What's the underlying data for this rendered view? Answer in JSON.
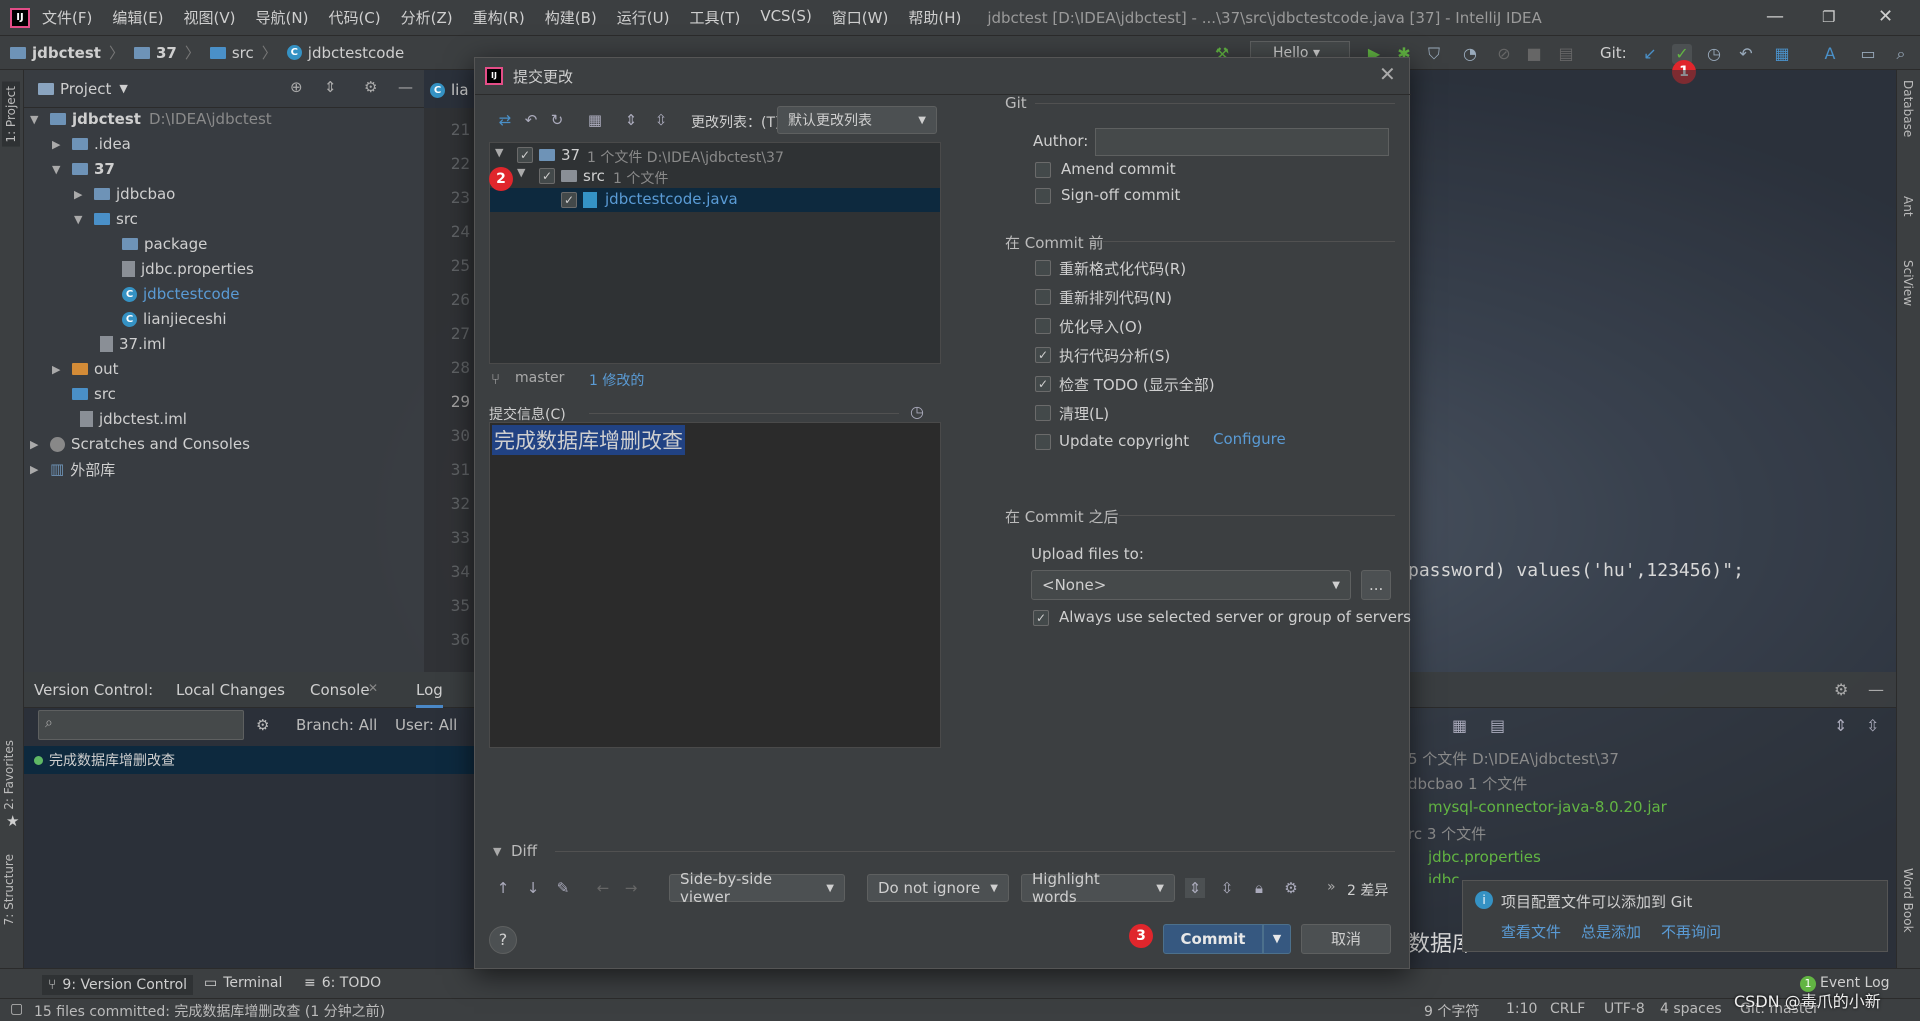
{
  "titlebar": {
    "menus": [
      "文件(F)",
      "编辑(E)",
      "视图(V)",
      "导航(N)",
      "代码(C)",
      "分析(Z)",
      "重构(R)",
      "构建(B)",
      "运行(U)",
      "工具(T)",
      "VCS(S)",
      "窗口(W)",
      "帮助(H)"
    ],
    "window_title": "jdbctest [D:\\IDEA\\jdbctest] - ...\\37\\src\\jdbctestcode.java [37] - IntelliJ IDEA",
    "min": "—",
    "max": "❐",
    "close": "✕"
  },
  "navbar": {
    "crumbs": [
      "jdbctest",
      "37",
      "src",
      "jdbctestcode"
    ],
    "run_config": "Hello",
    "git_label": "Git:"
  },
  "badges": {
    "one": "1",
    "two": "2",
    "three": "3"
  },
  "left_strip": {
    "project": "1: Project",
    "favorites": "2: Favorites",
    "structure": "7: Structure"
  },
  "right_strip": {
    "database": "Database",
    "ant": "Ant",
    "sciview": "SciView",
    "wordbook": "Word Book"
  },
  "project": {
    "header": "Project",
    "tree": [
      {
        "label": "jdbctest",
        "extra": "D:\\IDEA\\jdbctest"
      },
      {
        "label": ".idea"
      },
      {
        "label": "37"
      },
      {
        "label": "jdbcbao"
      },
      {
        "label": "src"
      },
      {
        "label": "package"
      },
      {
        "label": "jdbc.properties"
      },
      {
        "label": "jdbctestcode"
      },
      {
        "label": "lianjieceshi"
      },
      {
        "label": "37.iml"
      },
      {
        "label": "out"
      },
      {
        "label": "src"
      },
      {
        "label": "jdbctest.iml"
      },
      {
        "label": "Scratches and Consoles"
      },
      {
        "label": "外部库"
      }
    ]
  },
  "editor": {
    "tab": "lia",
    "lines": [
      "21",
      "22",
      "23",
      "24",
      "25",
      "26",
      "27",
      "28",
      "29",
      "30",
      "31",
      "32",
      "33",
      "34",
      "35",
      "36"
    ],
    "code_fragment": "password) values('hu',123456)\";"
  },
  "vc": {
    "label": "Version Control:",
    "tabs": [
      "Local Changes",
      "Console",
      "Log"
    ],
    "branch": "Branch: All",
    "user": "User: All",
    "commit_row": "完成数据库增删改查",
    "right_lines": [
      {
        "text": "5 个文件  D:\\IDEA\\jdbctest\\37",
        "cls": ""
      },
      {
        "text": "dbcbao  1 个文件",
        "cls": ""
      },
      {
        "text": "mysql-connector-java-8.0.20.jar",
        "cls": "green"
      },
      {
        "text": "rc  3 个文件",
        "cls": ""
      },
      {
        "text": "jdbc.properties",
        "cls": "green"
      },
      {
        "text": "jdbc",
        "cls": "green"
      }
    ],
    "behind_text": "数据库"
  },
  "notification": {
    "text": "项目配置文件可以添加到 Git",
    "view": "查看文件",
    "always": "总是添加",
    "never": "不再询问"
  },
  "bottom_tabs": {
    "vc": "9: Version Control",
    "terminal": "Terminal",
    "todo": "6: TODO",
    "eventlog": "Event Log",
    "event_count": "1"
  },
  "status": {
    "left": "15 files committed: 完成数据库增删改查 (1 分钟之前)",
    "chars": "9 个字符",
    "pos": "1:10",
    "crlf": "CRLF",
    "enc": "UTF-8",
    "indent": "4 spaces",
    "git": "Git: master"
  },
  "watermark": "CSDN @毒爪的小新",
  "dialog": {
    "title": "提交更改",
    "changelist_label": "更改列表：(T)",
    "changelist_value": "默认更改列表",
    "tree": {
      "module": "37",
      "module_info": "1 个文件  D:\\IDEA\\jdbctest\\37",
      "dir": "src",
      "dir_info": "1 个文件",
      "file": "jdbctestcode.java"
    },
    "branch": "master",
    "modified": "1 修改的",
    "message_label": "提交信息(C)",
    "message": "完成数据库增删改查",
    "git_section": "Git",
    "author_label": "Author:",
    "author_value": "",
    "amend": "Amend commit",
    "signoff": "Sign-off commit",
    "before_section": "在 Commit 前",
    "before_options": [
      {
        "label": "重新格式化代码(R)",
        "checked": false
      },
      {
        "label": "重新排列代码(N)",
        "checked": false
      },
      {
        "label": "优化导入(O)",
        "checked": false
      },
      {
        "label": "执行代码分析(S)",
        "checked": true
      },
      {
        "label": "检查 TODO (显示全部)",
        "checked": true
      },
      {
        "label": "清理(L)",
        "checked": false
      },
      {
        "label": "Update copyright",
        "checked": false
      }
    ],
    "configure": "Configure",
    "after_section": "在 Commit 之后",
    "upload_label": "Upload files to:",
    "upload_value": "<None>",
    "browse": "...",
    "always_server": "Always use selected server or group of servers",
    "diff_label": "Diff",
    "viewer": "Side-by-side viewer",
    "ignore": "Do not ignore",
    "highlight": "Highlight words",
    "diff_count": "2 差异",
    "help": "?",
    "commit": "Commit",
    "cancel": "取消"
  }
}
